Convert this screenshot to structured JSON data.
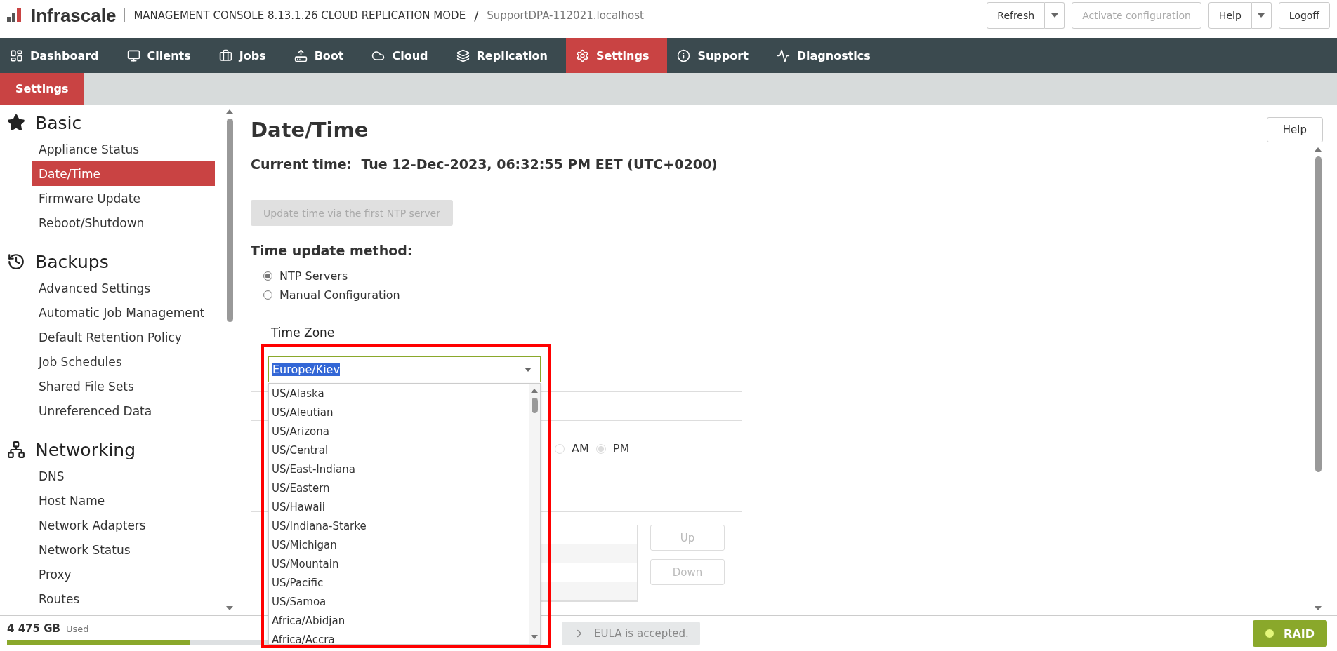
{
  "header": {
    "logo": "Infrascale",
    "product": "MANAGEMENT CONSOLE 8.13.1.26 CLOUD REPLICATION MODE",
    "separator": "/",
    "host": "SupportDPA-112021.localhost",
    "buttons": [
      {
        "label": "Refresh",
        "kind": "split",
        "disabled": false
      },
      {
        "label": "Activate configuration",
        "kind": "plain",
        "disabled": true
      },
      {
        "label": "Help",
        "kind": "split",
        "disabled": false
      },
      {
        "label": "Logoff",
        "kind": "plain",
        "disabled": false
      }
    ]
  },
  "nav": [
    {
      "label": "Dashboard",
      "selected": false
    },
    {
      "label": "Clients",
      "selected": false
    },
    {
      "label": "Jobs",
      "selected": false
    },
    {
      "label": "Boot",
      "selected": false
    },
    {
      "label": "Cloud",
      "selected": false
    },
    {
      "label": "Replication",
      "selected": false
    },
    {
      "label": "Settings",
      "selected": true
    },
    {
      "label": "Support",
      "selected": false
    },
    {
      "label": "Diagnostics",
      "selected": false
    }
  ],
  "subnav": [
    {
      "label": "Settings",
      "selected": true
    }
  ],
  "sidebar": [
    {
      "title": "Basic",
      "items": [
        {
          "label": "Appliance Status",
          "selected": false
        },
        {
          "label": "Date/Time",
          "selected": true
        },
        {
          "label": "Firmware Update",
          "selected": false
        },
        {
          "label": "Reboot/Shutdown",
          "selected": false
        }
      ]
    },
    {
      "title": "Backups",
      "items": [
        {
          "label": "Advanced Settings",
          "selected": false
        },
        {
          "label": "Automatic Job Management",
          "selected": false
        },
        {
          "label": "Default Retention Policy",
          "selected": false
        },
        {
          "label": "Job Schedules",
          "selected": false
        },
        {
          "label": "Shared File Sets",
          "selected": false
        },
        {
          "label": "Unreferenced Data",
          "selected": false
        }
      ]
    },
    {
      "title": "Networking",
      "items": [
        {
          "label": "DNS",
          "selected": false
        },
        {
          "label": "Host Name",
          "selected": false
        },
        {
          "label": "Network Adapters",
          "selected": false
        },
        {
          "label": "Network Status",
          "selected": false
        },
        {
          "label": "Proxy",
          "selected": false
        },
        {
          "label": "Routes",
          "selected": false
        }
      ]
    }
  ],
  "page": {
    "title": "Date/Time",
    "help": "Help",
    "current_time_label": "Current time:",
    "current_time": "Tue 12-Dec-2023, 06:32:55 PM EET (UTC+0200)",
    "update_button": {
      "label": "Update time via the first NTP server",
      "disabled": true
    },
    "method_title": "Time update method:",
    "methods": [
      {
        "label": "NTP Servers",
        "selected": true
      },
      {
        "label": "Manual Configuration",
        "selected": false
      }
    ],
    "timezone": {
      "legend": "Time Zone",
      "value": "Europe/Kiev",
      "expanded": true,
      "options": [
        "US/Alaska",
        "US/Aleutian",
        "US/Arizona",
        "US/Central",
        "US/East-Indiana",
        "US/Eastern",
        "US/Hawaii",
        "US/Indiana-Starke",
        "US/Michigan",
        "US/Mountain",
        "US/Pacific",
        "US/Samoa",
        "Africa/Abidjan",
        "Africa/Accra"
      ]
    },
    "ampm": [
      {
        "label": "AM",
        "selected": false
      },
      {
        "label": "PM",
        "selected": true
      }
    ],
    "server_buttons": [
      {
        "label": "Up",
        "disabled": true
      },
      {
        "label": "Down",
        "disabled": true
      }
    ]
  },
  "footer": {
    "storage": "4 475 GB",
    "storage_label": "Used",
    "level": 0.65,
    "eula": "EULA is accepted.",
    "raid": "RAID"
  }
}
